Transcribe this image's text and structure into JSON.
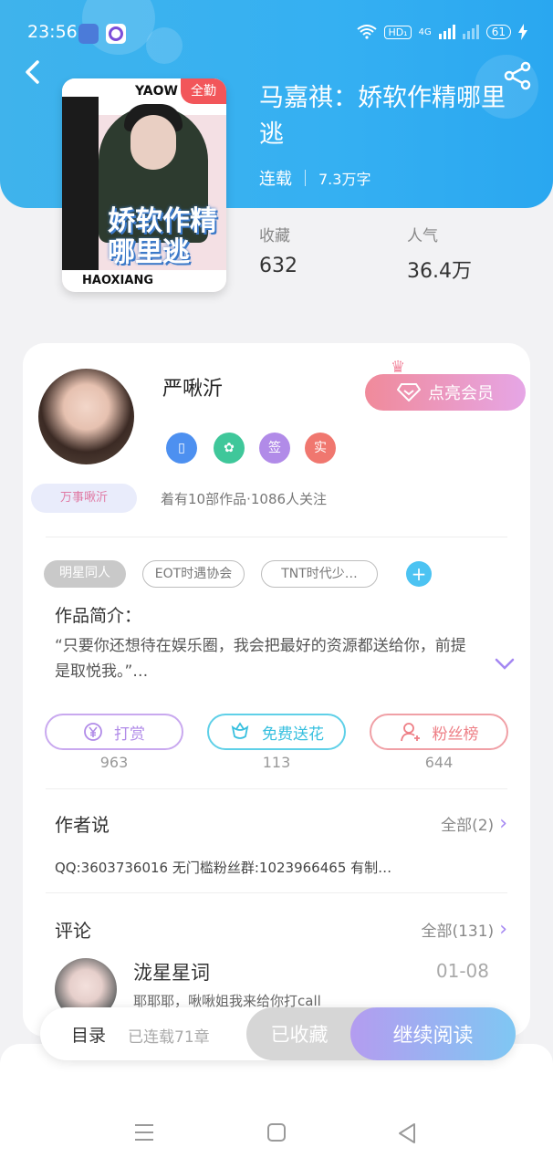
{
  "status_bar": {
    "time": "23:56",
    "hd": "HD₁",
    "network": "4G",
    "battery": "61"
  },
  "book": {
    "title": "马嘉祺：娇软作精哪里逃",
    "status": "连载",
    "word_count": "7.3万字",
    "tag": "全勤",
    "cover_top_word": "YAOW",
    "cover_title": "娇软作精哪里逃",
    "cover_bottom_word": "HAOXIANG"
  },
  "stats": [
    {
      "label": "收藏",
      "value": "632"
    },
    {
      "label": "人气",
      "value": "36.4万"
    }
  ],
  "author": {
    "name": "严啾沂",
    "nickname_tag": "万事啾沂",
    "vip_button": "点亮会员",
    "badges": [
      "phone",
      "flower",
      "签",
      "实"
    ],
    "info": "着有10部作品·1086人关注"
  },
  "tags": [
    "明星同人",
    "EOT时遇协会",
    "TNT时代少…"
  ],
  "intro": {
    "heading": "作品简介：",
    "text": "“只要你还想待在娱乐圈，我会把最好的资源都送给你，前提是取悦我。”…"
  },
  "actions": [
    {
      "label": "打赏",
      "count": "963",
      "icon": "yen-icon"
    },
    {
      "label": "免费送花",
      "count": "113",
      "icon": "flower-icon"
    },
    {
      "label": "粉丝榜",
      "count": "644",
      "icon": "fans-icon"
    }
  ],
  "author_says": {
    "heading": "作者说",
    "more": "全部(2)",
    "text": "QQ:3603736016 无门槛粉丝群:1023966465 有制…"
  },
  "comments": {
    "heading": "评论",
    "more": "全部(131)",
    "items": [
      {
        "name": "泷星星词",
        "date": "01-08",
        "text": "耶耶耶，啾啾姐我来给你打call"
      }
    ]
  },
  "bottom_bar": {
    "toc": "目录",
    "toc_sub": "已连载71章",
    "collected": "已收藏",
    "continue": "继续阅读"
  },
  "colors": {
    "header": "#35b0f2",
    "accent": "#a487f2",
    "vip": "#f08a9a"
  }
}
